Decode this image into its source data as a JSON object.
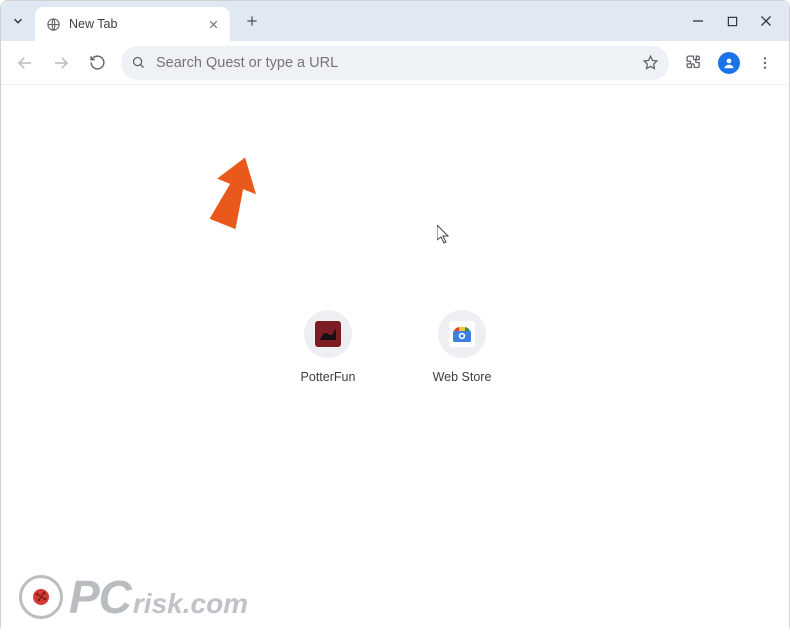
{
  "tab": {
    "title": "New Tab"
  },
  "omnibox": {
    "placeholder": "Search Quest or type a URL"
  },
  "shortcuts": {
    "potterfun": {
      "label": "PotterFun"
    },
    "webstore": {
      "label": "Web Store"
    }
  },
  "watermark": {
    "pc": "PC",
    "risk": "risk.com"
  },
  "icons": {
    "globe": "globe-icon",
    "close": "close-icon",
    "plus": "plus-icon",
    "chevron_down": "chevron-down-icon",
    "minimize": "minimize-icon",
    "maximize": "maximize-icon",
    "window_close": "window-close-icon",
    "back": "back-icon",
    "forward": "forward-icon",
    "reload": "reload-icon",
    "search": "search-icon",
    "star": "star-icon",
    "extensions": "extensions-icon",
    "profile": "profile-icon",
    "menu": "menu-icon"
  }
}
